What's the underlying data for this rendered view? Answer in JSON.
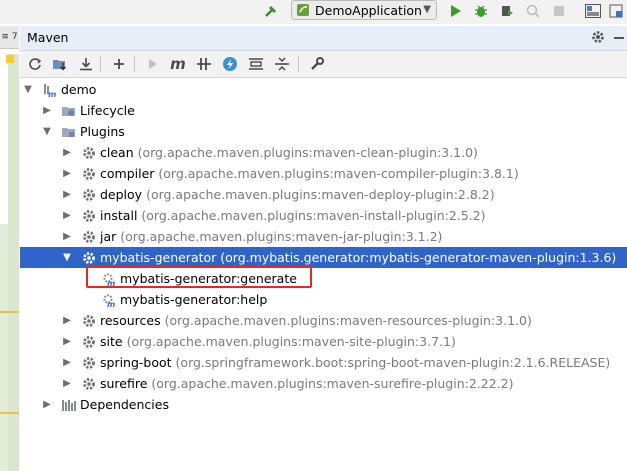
{
  "run_config": {
    "name": "DemoApplication"
  },
  "panel": {
    "title": "Maven"
  },
  "gutter": {
    "tab_label": "≡ 7"
  },
  "toolbar": {
    "items": [
      {
        "name": "reload-icon",
        "glyph": "⟳"
      },
      {
        "name": "generate-sources-icon",
        "glyph": "⬇"
      },
      {
        "name": "download-icon",
        "glyph": "⤓"
      },
      {
        "name": "add-icon",
        "glyph": "+"
      },
      {
        "name": "run-icon",
        "glyph": "▶"
      },
      {
        "name": "execute-goal-icon",
        "glyph": "m"
      },
      {
        "name": "toggle-offline-icon",
        "glyph": "#"
      },
      {
        "name": "skip-tests-icon",
        "glyph": "⚡"
      },
      {
        "name": "show-dependencies-icon",
        "glyph": "═"
      },
      {
        "name": "collapse-all-icon",
        "glyph": "≣"
      },
      {
        "name": "settings-wrench-icon",
        "glyph": "⚒"
      }
    ]
  },
  "tree": {
    "root": "demo",
    "lifecycle": "Lifecycle",
    "plugins_label": "Plugins",
    "dependencies": "Dependencies",
    "plugins": [
      {
        "name": "clean",
        "detail": "(org.apache.maven.plugins:maven-clean-plugin:3.1.0)"
      },
      {
        "name": "compiler",
        "detail": "(org.apache.maven.plugins:maven-compiler-plugin:3.8.1)"
      },
      {
        "name": "deploy",
        "detail": "(org.apache.maven.plugins:maven-deploy-plugin:2.8.2)"
      },
      {
        "name": "install",
        "detail": "(org.apache.maven.plugins:maven-install-plugin:2.5.2)"
      },
      {
        "name": "jar",
        "detail": "(org.apache.maven.plugins:maven-jar-plugin:3.1.2)"
      },
      {
        "name": "mybatis-generator",
        "detail": "(org.mybatis.generator:mybatis-generator-maven-plugin:1.3.6)"
      },
      {
        "name": "resources",
        "detail": "(org.apache.maven.plugins:maven-resources-plugin:3.1.0)"
      },
      {
        "name": "site",
        "detail": "(org.apache.maven.plugins:maven-site-plugin:3.7.1)"
      },
      {
        "name": "spring-boot",
        "detail": "(org.springframework.boot:spring-boot-maven-plugin:2.1.6.RELEASE)"
      },
      {
        "name": "surefire",
        "detail": "(org.apache.maven.plugins:maven-surefire-plugin:2.22.2)"
      }
    ],
    "goals": [
      "mybatis-generator:generate",
      "mybatis-generator:help"
    ]
  },
  "colors": {
    "selection": "#2f65ca",
    "highlight_border": "#e5272a"
  }
}
